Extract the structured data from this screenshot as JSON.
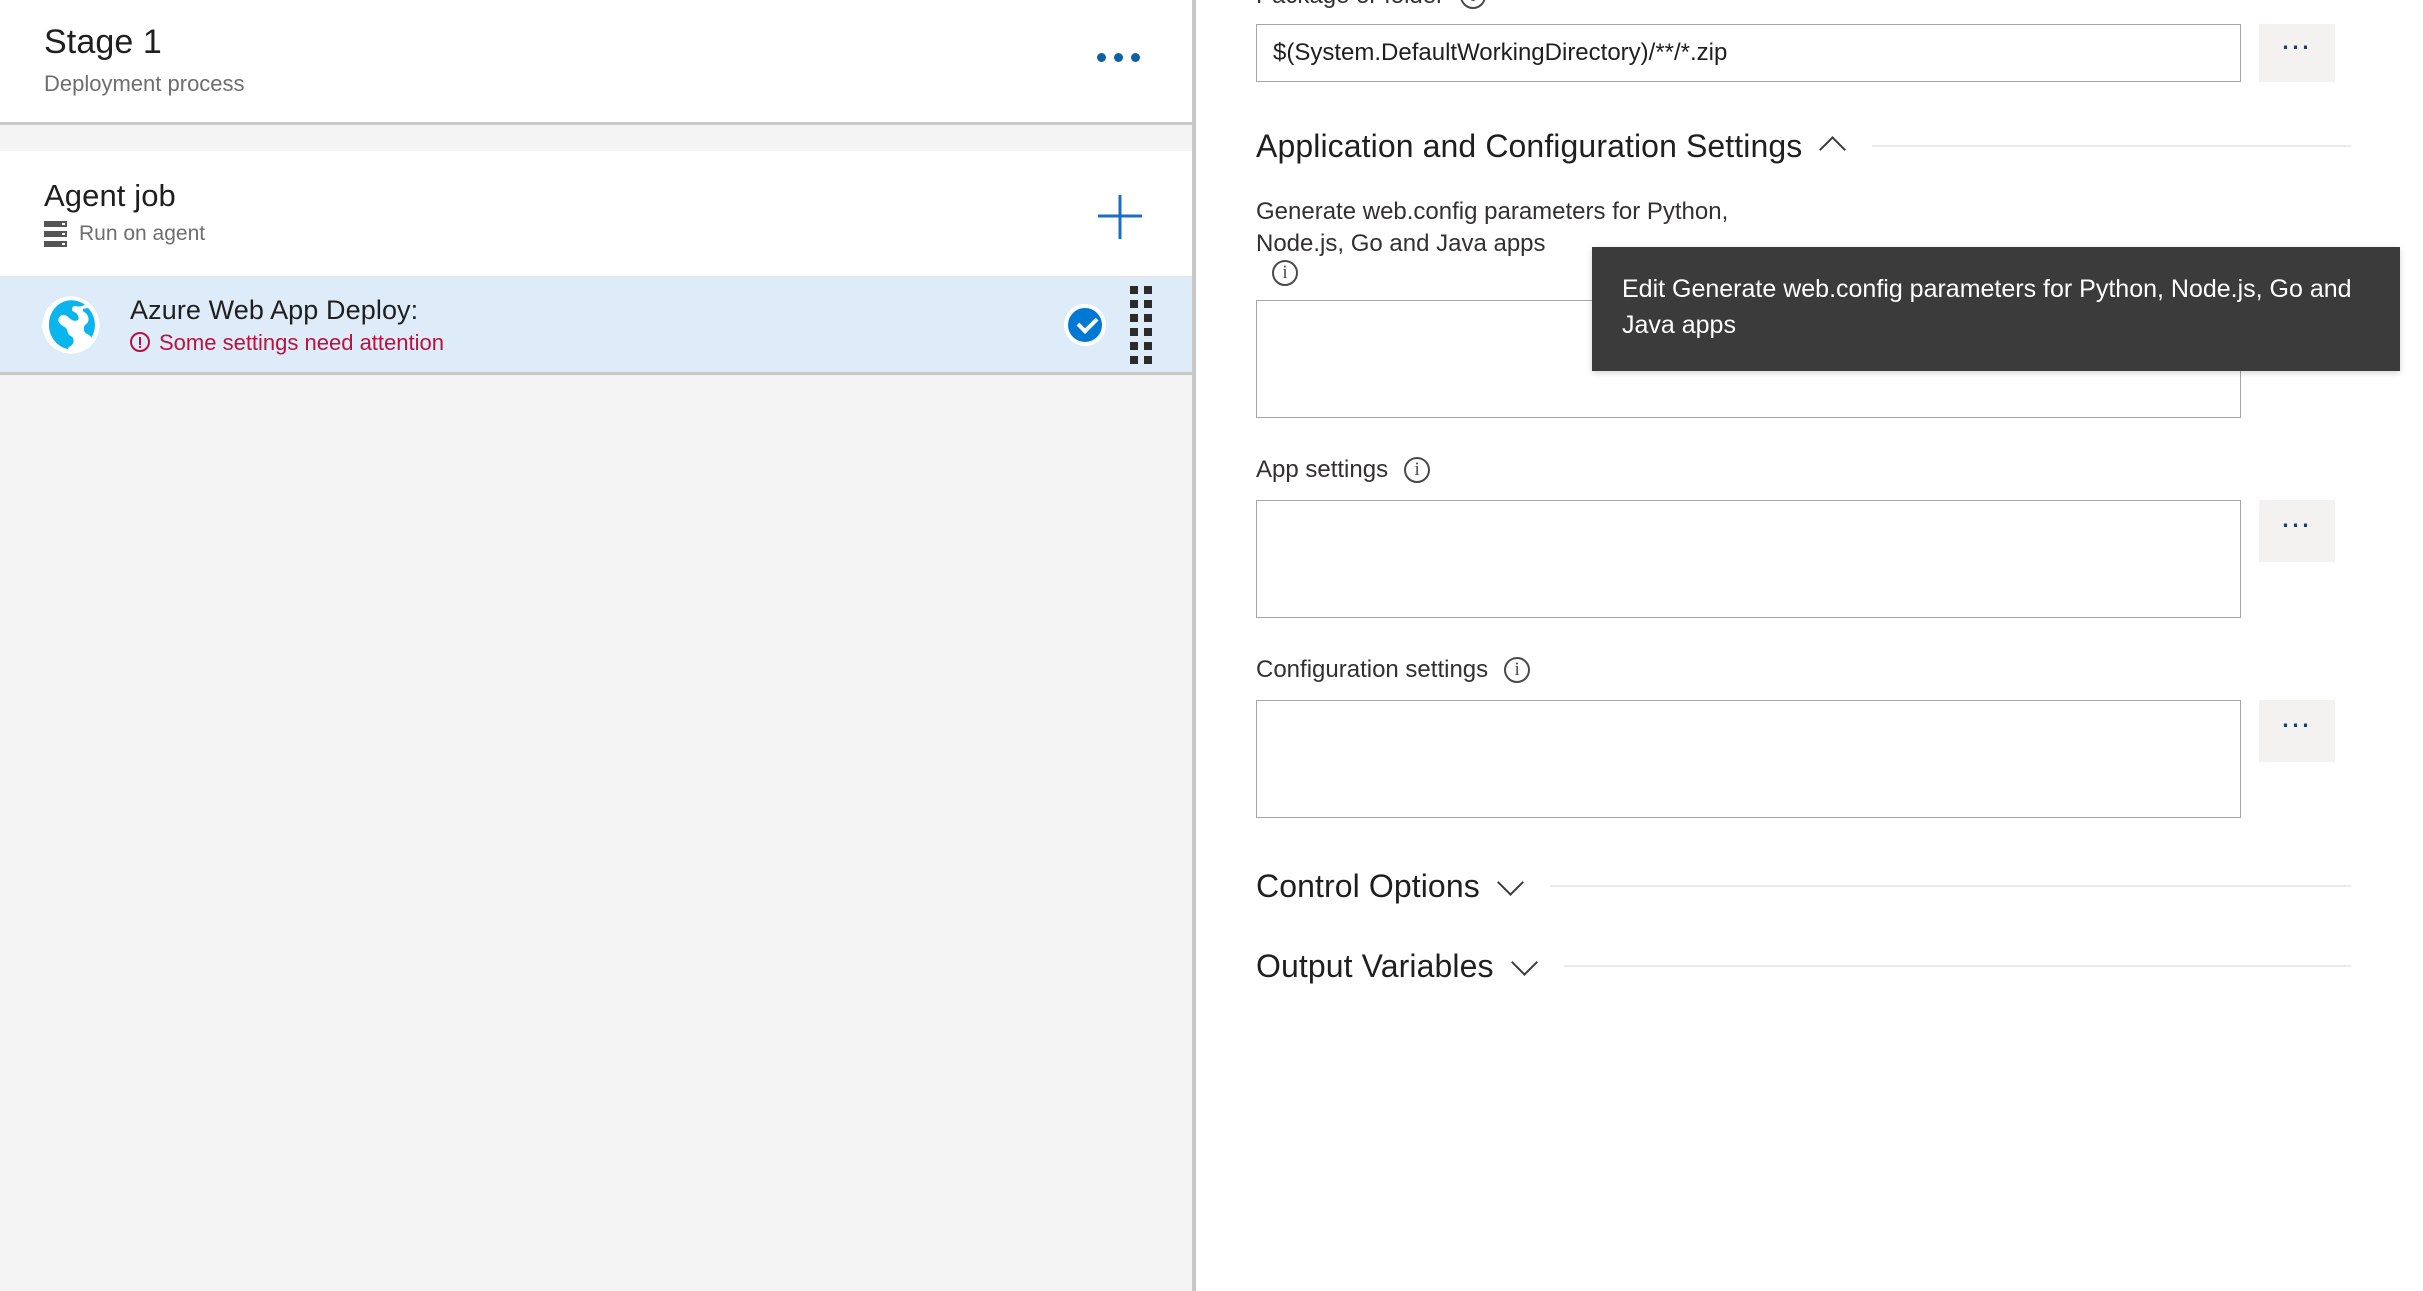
{
  "left_pane": {
    "stage": {
      "title": "Stage 1",
      "subtitle": "Deployment process",
      "more_menu_label": "...",
      "accent_color": "#0b61a4"
    },
    "job": {
      "title": "Agent job",
      "subtitle": "Run on agent",
      "add_button_label": "+",
      "add_button_color": "#1b6ec2"
    },
    "task": {
      "name": "Azure Web App Deploy:",
      "warning": "Some settings need attention",
      "warning_color": "#b8123f",
      "selected_background": "#deecf9",
      "status_color": "#0078d4",
      "icon": "azure-web-app-globe-icon"
    }
  },
  "right_pane": {
    "fields": [
      {
        "label": "Package or folder",
        "info_icon": "info-icon",
        "value": "$(System.DefaultWorkingDirectory)/**/*.zip",
        "browse_label": "⋯",
        "type": "text"
      }
    ],
    "sections": [
      {
        "title": "Application and Configuration Settings",
        "state": "expanded",
        "chevron": "chevron-up-icon"
      },
      {
        "title": "Control Options",
        "state": "collapsed",
        "chevron": "chevron-down-icon"
      },
      {
        "title": "Output Variables",
        "state": "collapsed",
        "chevron": "chevron-down-icon"
      }
    ],
    "app_config_fields": [
      {
        "label": "Generate web.config parameters for Python, Node.js, Go and Java apps",
        "info_icon": "info-icon",
        "value": "",
        "browse_label": "⋯",
        "type": "textarea"
      },
      {
        "label": "App settings",
        "info_icon": "info-icon",
        "value": "",
        "browse_label": "⋯",
        "type": "textarea"
      },
      {
        "label": "Configuration settings",
        "info_icon": "info-icon",
        "value": "",
        "browse_label": "⋯",
        "type": "textarea"
      }
    ]
  },
  "tooltip": {
    "text": "Edit Generate web.config parameters for Python, Node.js, Go and Java apps",
    "background": "#3b3b3b",
    "color": "#ffffff"
  }
}
